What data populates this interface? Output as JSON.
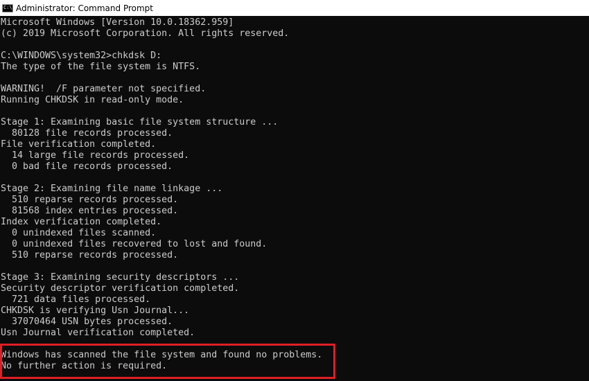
{
  "window": {
    "title": "Administrator: Command Prompt",
    "icon": "command-prompt-icon",
    "icon_glyph": "C:\\"
  },
  "console": {
    "lines": [
      "Microsoft Windows [Version 10.0.18362.959]",
      "(c) 2019 Microsoft Corporation. All rights reserved.",
      "",
      "C:\\WINDOWS\\system32>chkdsk D:",
      "The type of the file system is NTFS.",
      "",
      "WARNING!  /F parameter not specified.",
      "Running CHKDSK in read-only mode.",
      "",
      "Stage 1: Examining basic file system structure ...",
      "  80128 file records processed.",
      "File verification completed.",
      "  14 large file records processed.",
      "  0 bad file records processed.",
      "",
      "Stage 2: Examining file name linkage ...",
      "  510 reparse records processed.",
      "  81568 index entries processed.",
      "Index verification completed.",
      "  0 unindexed files scanned.",
      "  0 unindexed files recovered to lost and found.",
      "  510 reparse records processed.",
      "",
      "Stage 3: Examining security descriptors ...",
      "Security descriptor verification completed.",
      "  721 data files processed.",
      "CHKDSK is verifying Usn Journal...",
      "  37070464 USN bytes processed.",
      "Usn Journal verification completed.",
      "",
      "Windows has scanned the file system and found no problems.",
      "No further action is required."
    ]
  },
  "colors": {
    "console_background": "#0c0c0c",
    "console_text": "#cccccc",
    "titlebar_background": "#ffffff",
    "highlight_border": "#e01e26"
  }
}
